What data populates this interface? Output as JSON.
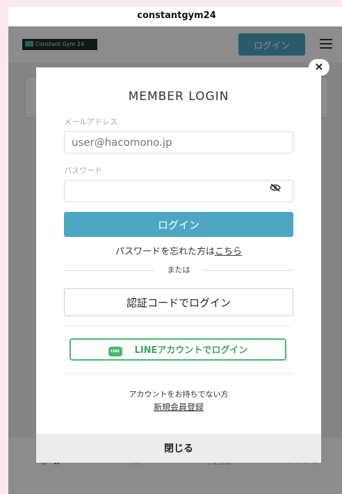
{
  "browser": {
    "url_title": "constantgym24"
  },
  "header": {
    "logo_text": "Constant Gym 24",
    "login_button": "ログイン"
  },
  "tabbar": {
    "items": [
      {
        "label": "ホーム",
        "active": true
      },
      {
        "label": "予約",
        "active": false
      },
      {
        "label": "予定管理",
        "active": false
      },
      {
        "label": "マイページ",
        "active": false
      }
    ]
  },
  "modal": {
    "title": "MEMBER LOGIN",
    "email_label": "メールアドレス",
    "email_placeholder": "user@hacomono.jp",
    "password_label": "パスワード",
    "password_value": "",
    "login_button": "ログイン",
    "forgot_prefix": "パスワードを忘れた方は",
    "forgot_link": "こちら",
    "or_text": "または",
    "code_login_button": "認証コードでログイン",
    "line_icon_text": "LINE",
    "line_login_button": "LINEアカウントでログイン",
    "no_account_text": "アカウントをお持ちでない方",
    "signup_link": "新規会員登録",
    "close_button": "閉じる",
    "close_icon": "×"
  },
  "colors": {
    "accent": "#4da7c4",
    "line_green": "#48b86f",
    "page_bg": "#fce9ee"
  }
}
